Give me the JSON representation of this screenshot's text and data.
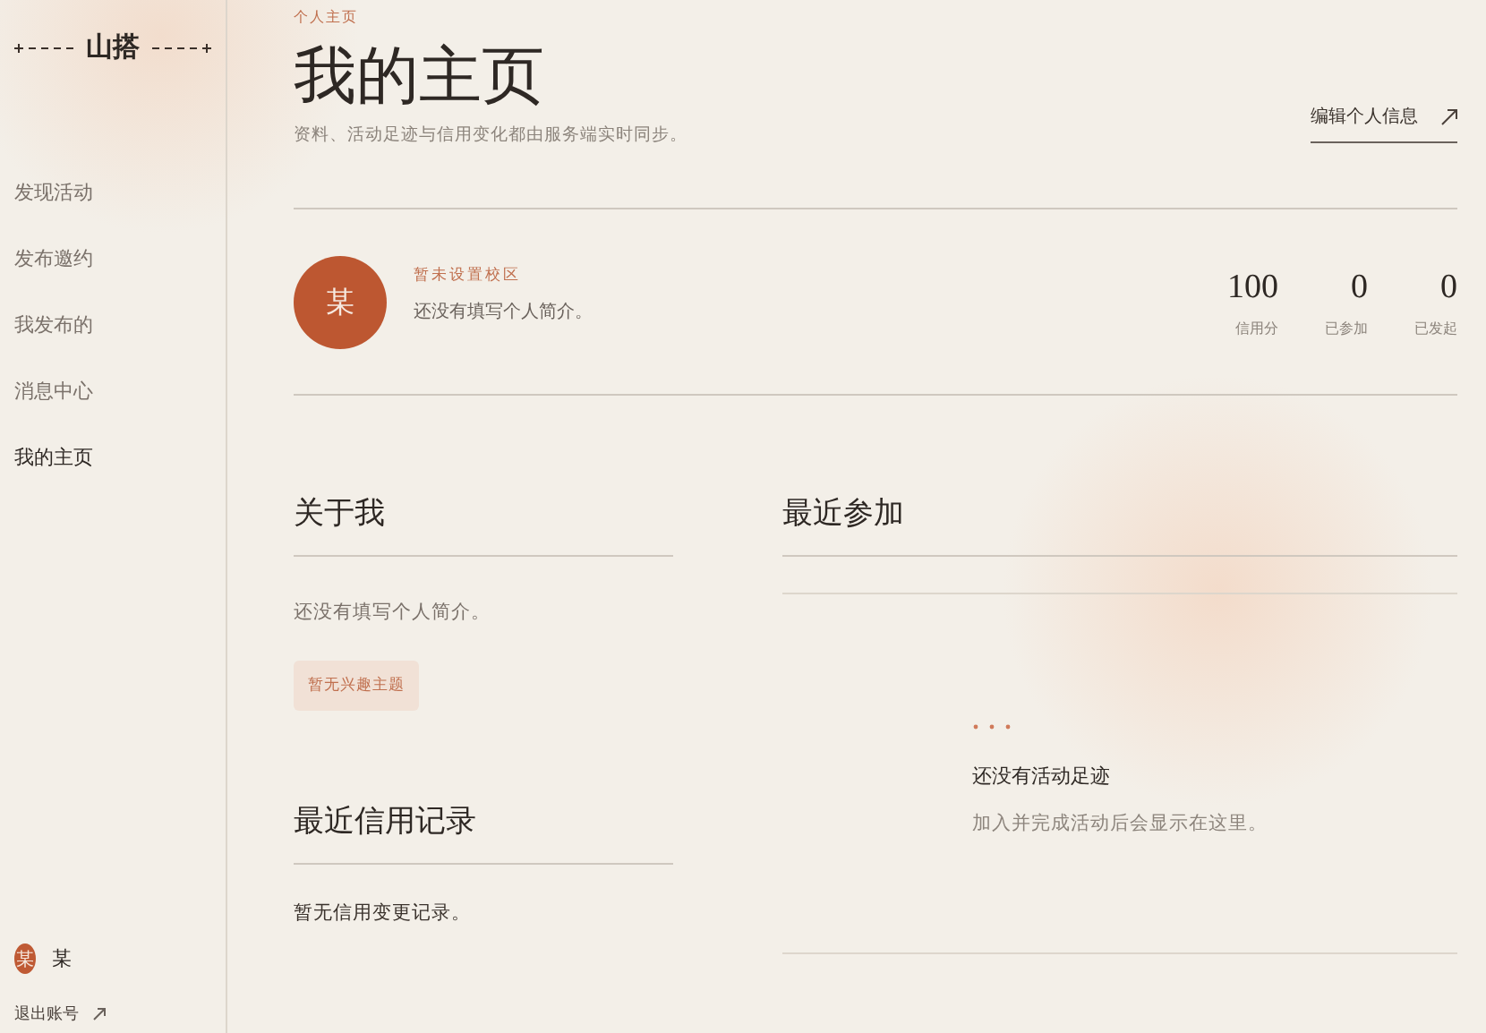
{
  "sidebar": {
    "logo": "山搭",
    "items": [
      {
        "label": "发现活动",
        "selected": false
      },
      {
        "label": "发布邀约",
        "selected": false
      },
      {
        "label": "我发布的",
        "selected": false
      },
      {
        "label": "消息中心",
        "selected": false
      },
      {
        "label": "我的主页",
        "selected": true
      }
    ],
    "user": {
      "avatar": "某",
      "name": "某"
    },
    "logout": "退出账号"
  },
  "header": {
    "eyebrow": "个人主页",
    "title": "我的主页",
    "subtitle": "资料、活动足迹与信用变化都由服务端实时同步。",
    "edit_link": "编辑个人信息"
  },
  "profile": {
    "avatar": "某",
    "campus": "暂未设置校区",
    "bio": "还没有填写个人简介。",
    "stats": [
      {
        "value": "100",
        "label": "信用分"
      },
      {
        "value": "0",
        "label": "已参加"
      },
      {
        "value": "0",
        "label": "已发起"
      }
    ]
  },
  "about": {
    "title": "关于我",
    "text": "还没有填写个人简介。",
    "tag": "暂无兴趣主题"
  },
  "credit": {
    "title": "最近信用记录",
    "text": "暂无信用变更记录。"
  },
  "recent": {
    "title": "最近参加",
    "empty_title": "还没有活动足迹",
    "empty_text": "加入并完成活动后会显示在这里。"
  }
}
